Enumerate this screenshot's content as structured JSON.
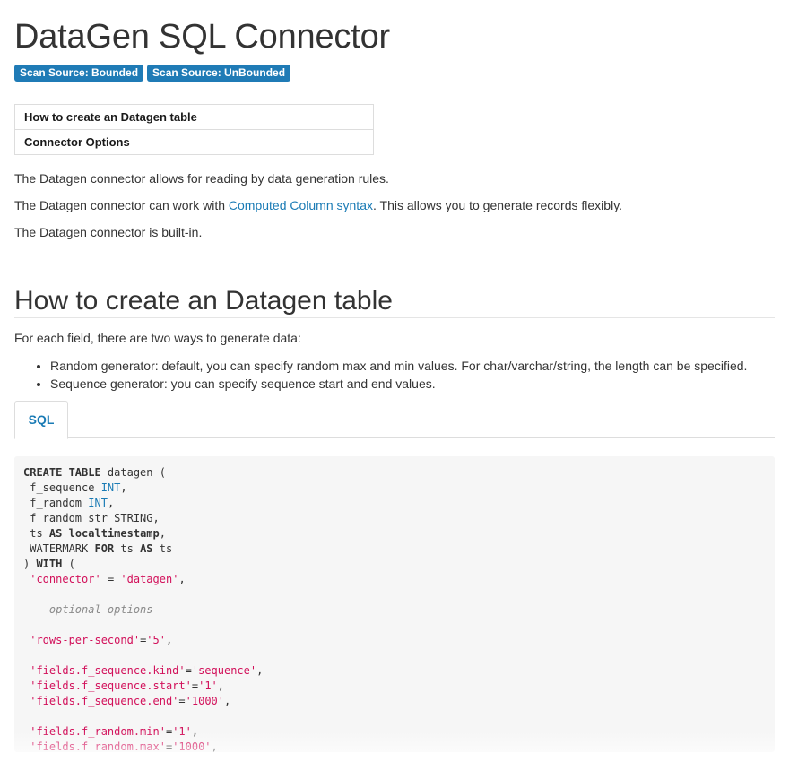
{
  "page_title": "DataGen SQL Connector",
  "badges": [
    "Scan Source: Bounded",
    "Scan Source: UnBounded"
  ],
  "toc": [
    "How to create an Datagen table",
    "Connector Options"
  ],
  "intro_paragraphs": {
    "p1": "The Datagen connector allows for reading by data generation rules.",
    "p2_before": "The Datagen connector can work with ",
    "p2_link": "Computed Column syntax",
    "p2_after": ". This allows you to generate records flexibly.",
    "p3": "The Datagen connector is built-in."
  },
  "section": {
    "title": "How to create an Datagen table",
    "intro": "For each field, there are two ways to generate data:",
    "bullets": [
      "Random generator: default, you can specify random max and min values. For char/varchar/string, the length can be specified.",
      "Sequence generator: you can specify sequence start and end values."
    ],
    "tab_label": "SQL"
  },
  "code": {
    "l1_kw": "CREATE TABLE",
    "l1_rest": " datagen (",
    "l2_name": " f_sequence ",
    "l2_type": "INT",
    "l2_end": ",",
    "l3_name": " f_random ",
    "l3_type": "INT",
    "l3_end": ",",
    "l4": " f_random_str STRING,",
    "l5_a": " ts ",
    "l5_kw1": "AS",
    "l5_sp": " ",
    "l5_kw2": "localtimestamp",
    "l5_end": ",",
    "l6_a": " WATERMARK ",
    "l6_kw1": "FOR",
    "l6_b": " ts ",
    "l6_kw2": "AS",
    "l6_c": " ts",
    "l7_a": ") ",
    "l7_kw": "WITH",
    "l7_b": " (",
    "l8_sp": " ",
    "l8_s1": "'connector'",
    "l8_eq": " = ",
    "l8_s2": "'datagen'",
    "l8_end": ",",
    "l10": " -- optional options --",
    "l12_sp": " ",
    "l12_s1": "'rows-per-second'",
    "l12_eq": "=",
    "l12_s2": "'5'",
    "l12_end": ",",
    "l14_sp": " ",
    "l14_s1": "'fields.f_sequence.kind'",
    "l14_eq": "=",
    "l14_s2": "'sequence'",
    "l14_end": ",",
    "l15_sp": " ",
    "l15_s1": "'fields.f_sequence.start'",
    "l15_eq": "=",
    "l15_s2": "'1'",
    "l15_end": ",",
    "l16_sp": " ",
    "l16_s1": "'fields.f_sequence.end'",
    "l16_eq": "=",
    "l16_s2": "'1000'",
    "l16_end": ",",
    "l18_sp": " ",
    "l18_s1": "'fields.f_random.min'",
    "l18_eq": "=",
    "l18_s2": "'1'",
    "l18_end": ",",
    "l19_sp": " ",
    "l19_s1": "'fields.f_random.max'",
    "l19_eq": "=",
    "l19_s2": "'1000'",
    "l19_end": ","
  }
}
